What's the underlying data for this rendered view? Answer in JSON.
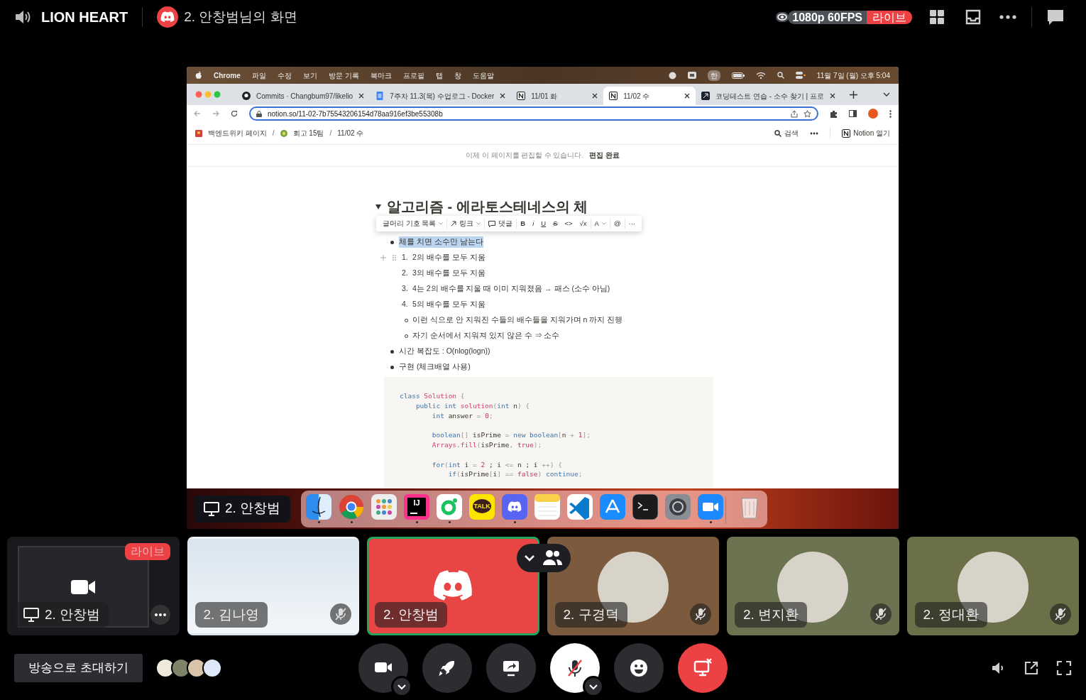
{
  "top_bar": {
    "server": "LION HEART",
    "stream_title": "2. 안창범님의 화면",
    "quality": "1080p 60FPS",
    "live_badge": "라이브"
  },
  "shared_screen": {
    "menu_bar": {
      "app": "Chrome",
      "menus": [
        "파일",
        "수정",
        "보기",
        "방문 기록",
        "북마크",
        "프로필",
        "탭",
        "창",
        "도움말"
      ],
      "input_source": "한",
      "clock": "11월 7일 (월) 오후 5:04"
    },
    "tabs": [
      {
        "kind": "github",
        "title": "Commits · Changbum97/likelio",
        "selected": false
      },
      {
        "kind": "docs",
        "title": "7주차 11.3(목) 수업로그 - Docker",
        "selected": false
      },
      {
        "kind": "notion",
        "title": "11/01 화",
        "selected": false
      },
      {
        "kind": "notion",
        "title": "11/02 수",
        "selected": true
      },
      {
        "kind": "code",
        "title": "코딩테스트 연습 - 소수 찾기 | 프로",
        "selected": false
      }
    ],
    "address": "notion.so/11-02-7b75543206154d78aa916ef3be55308b",
    "breadcrumbs": [
      {
        "kind": "page",
        "label": "백엔드위키 페이지"
      },
      {
        "kind": "separator",
        "label": "/"
      },
      {
        "kind": "team",
        "label": "회고 15팀"
      },
      {
        "kind": "separator",
        "label": "/"
      },
      {
        "kind": "plain",
        "label": "11/02 수"
      }
    ],
    "search": "검색",
    "open_in_app": "Notion 열기",
    "edit_banner": {
      "text": "이제 이 페이지를 편집할 수 있습니다.",
      "action": "편집 완료"
    },
    "heading": "알고리즘 - 에라토스테네스의 체",
    "format_toolbar": [
      {
        "kind": "dropdown",
        "label": "글머리 기호 목록",
        "divider_before": false
      },
      {
        "kind": "link",
        "label": "링크",
        "divider_before": true
      },
      {
        "kind": "comment",
        "label": "댓글",
        "divider_before": true
      },
      {
        "kind": "bold",
        "label": "B",
        "divider_before": true
      },
      {
        "kind": "italic",
        "label": "i",
        "divider_before": false
      },
      {
        "kind": "underline",
        "label": "U",
        "divider_before": false
      },
      {
        "kind": "strike",
        "label": "S",
        "divider_before": false
      },
      {
        "kind": "plain",
        "label": "<>",
        "divider_before": false
      },
      {
        "kind": "plain",
        "label": "√x",
        "divider_before": false
      },
      {
        "kind": "dropdown",
        "label": "A",
        "divider_before": true
      },
      {
        "kind": "plain",
        "label": "@",
        "divider_before": true
      },
      {
        "kind": "plain",
        "label": "···",
        "divider_before": true
      }
    ],
    "blocks": [
      {
        "kind": "bullet",
        "text": "체를 치면 소수만 남는다",
        "highlighted": true,
        "children": [
          {
            "kind": "number",
            "marker": "1.",
            "text": "2의 배수를 모두 지움",
            "show_handles": true
          },
          {
            "kind": "number",
            "marker": "2.",
            "text": "3의 배수를 모두 지움",
            "show_handles": false
          },
          {
            "kind": "number",
            "marker": "3.",
            "text": "4는 2의 배수를 지울 때 이미 지워졌음 → 패스 (소수 아님)",
            "show_handles": false
          },
          {
            "kind": "number",
            "marker": "4.",
            "text": "5의 배수를 모두 지움",
            "show_handles": false
          },
          {
            "kind": "circle",
            "text": "이런 식으로 안 지워진 수들의 배수들을 지워가며 n 까지 진행",
            "show_handles": false
          },
          {
            "kind": "circle",
            "text": "자기 순서에서 지워져 있지 않은 수 ⇒ 소수",
            "show_handles": false
          }
        ]
      },
      {
        "kind": "bullet",
        "text": "시간 복잡도 : O(nlog(logn))",
        "highlighted": false
      },
      {
        "kind": "bullet",
        "text": "구현 (체크배열 사용)",
        "highlighted": false
      }
    ],
    "code": [
      {
        "gap_before": false,
        "tokens": [
          {
            "text": "class ",
            "kind": "keyword"
          },
          {
            "text": "Solution",
            "kind": "name"
          },
          {
            "text": " {",
            "kind": "punct"
          }
        ]
      },
      {
        "gap_before": false,
        "tokens": [
          {
            "text": "    public int ",
            "kind": "keyword"
          },
          {
            "text": "solution",
            "kind": "name"
          },
          {
            "text": "(",
            "kind": "punct"
          },
          {
            "text": "int",
            "kind": "keyword"
          },
          {
            "text": " n",
            "kind": "plain"
          },
          {
            "text": ") {",
            "kind": "punct"
          }
        ]
      },
      {
        "gap_before": false,
        "tokens": [
          {
            "text": "        int",
            "kind": "keyword"
          },
          {
            "text": " answer ",
            "kind": "plain"
          },
          {
            "text": "= ",
            "kind": "punct"
          },
          {
            "text": "0",
            "kind": "value"
          },
          {
            "text": ";",
            "kind": "punct"
          }
        ]
      },
      {
        "gap_before": true,
        "tokens": [
          {
            "text": "        boolean",
            "kind": "keyword"
          },
          {
            "text": "[]",
            "kind": "punct"
          },
          {
            "text": " isPrime ",
            "kind": "plain"
          },
          {
            "text": "= ",
            "kind": "punct"
          },
          {
            "text": "new boolean",
            "kind": "keyword"
          },
          {
            "text": "[",
            "kind": "punct"
          },
          {
            "text": "n ",
            "kind": "plain"
          },
          {
            "text": "+ ",
            "kind": "punct"
          },
          {
            "text": "1",
            "kind": "value"
          },
          {
            "text": "];",
            "kind": "punct"
          }
        ]
      },
      {
        "gap_before": false,
        "tokens": [
          {
            "text": "        Arrays.fill",
            "kind": "name"
          },
          {
            "text": "(",
            "kind": "punct"
          },
          {
            "text": "isPrime",
            "kind": "plain"
          },
          {
            "text": ", ",
            "kind": "punct"
          },
          {
            "text": "true",
            "kind": "value"
          },
          {
            "text": ");",
            "kind": "punct"
          }
        ]
      },
      {
        "gap_before": true,
        "tokens": [
          {
            "text": "        for",
            "kind": "keyword"
          },
          {
            "text": "(",
            "kind": "punct"
          },
          {
            "text": "int",
            "kind": "keyword"
          },
          {
            "text": " i ",
            "kind": "plain"
          },
          {
            "text": "= ",
            "kind": "punct"
          },
          {
            "text": "2",
            "kind": "value"
          },
          {
            "text": " ; i ",
            "kind": "plain"
          },
          {
            "text": "<=",
            "kind": "punct"
          },
          {
            "text": " n ; i ",
            "kind": "plain"
          },
          {
            "text": "++) {",
            "kind": "punct"
          }
        ]
      },
      {
        "gap_before": false,
        "tokens": [
          {
            "text": "            if",
            "kind": "keyword"
          },
          {
            "text": "(",
            "kind": "punct"
          },
          {
            "text": "isPrime",
            "kind": "plain"
          },
          {
            "text": "[",
            "kind": "punct"
          },
          {
            "text": "i",
            "kind": "plain"
          },
          {
            "text": "] == ",
            "kind": "punct"
          },
          {
            "text": "false",
            "kind": "value"
          },
          {
            "text": ") ",
            "kind": "punct"
          },
          {
            "text": "continue",
            "kind": "keyword"
          },
          {
            "text": ";",
            "kind": "punct"
          }
        ]
      }
    ],
    "presenter": "2. 안창범",
    "dock": [
      {
        "kind": "finder",
        "running": true
      },
      {
        "kind": "chrome",
        "running": true
      },
      {
        "kind": "launchpad",
        "running": false
      },
      {
        "kind": "ide",
        "label": "IJ",
        "running": true
      },
      {
        "kind": "ring",
        "running": true
      },
      {
        "kind": "chat",
        "label": "TALK",
        "running": false
      },
      {
        "kind": "discord",
        "running": true
      },
      {
        "kind": "notes",
        "running": false
      },
      {
        "kind": "editor",
        "running": false
      },
      {
        "kind": "store",
        "running": false
      },
      {
        "kind": "terminal",
        "running": false
      },
      {
        "kind": "settings",
        "running": false
      },
      {
        "kind": "video",
        "running": true
      },
      {
        "kind": "trash",
        "running": false
      }
    ]
  },
  "tiles": [
    {
      "kind": "screen",
      "name": "2. 안창범",
      "live_badge": "라이브",
      "speaking": false,
      "muted": false,
      "color": "#1a1a1e"
    },
    {
      "kind": "plain",
      "name": "2. 김나영",
      "speaking": false,
      "muted": true,
      "color": "#d9e5ef"
    },
    {
      "kind": "discord",
      "name": "2. 안창범",
      "speaking": true,
      "muted": false,
      "color": "#e84545"
    },
    {
      "kind": "avatar",
      "name": "2. 구경덕",
      "speaking": false,
      "muted": true,
      "color": "#7c5a3e"
    },
    {
      "kind": "avatar",
      "name": "2. 변지환",
      "speaking": false,
      "muted": true,
      "color": "#6b7350"
    },
    {
      "kind": "avatar",
      "name": "2. 정대환",
      "speaking": false,
      "muted": true,
      "color": "#6c7048"
    }
  ],
  "invite": "방송으로 초대하기",
  "viewers": [
    {
      "color": "#efe9dc"
    },
    {
      "color": "#7d8468"
    },
    {
      "color": "#d8c4a8"
    },
    {
      "color": "#dde9fa"
    }
  ],
  "controls": [
    {
      "kind": "camera",
      "has_menu": true
    },
    {
      "kind": "activity",
      "has_menu": false
    },
    {
      "kind": "share",
      "has_menu": false
    },
    {
      "kind": "mic",
      "muted": true,
      "has_menu": true
    },
    {
      "kind": "emoji",
      "has_menu": false
    },
    {
      "kind": "stop",
      "has_menu": false
    }
  ]
}
